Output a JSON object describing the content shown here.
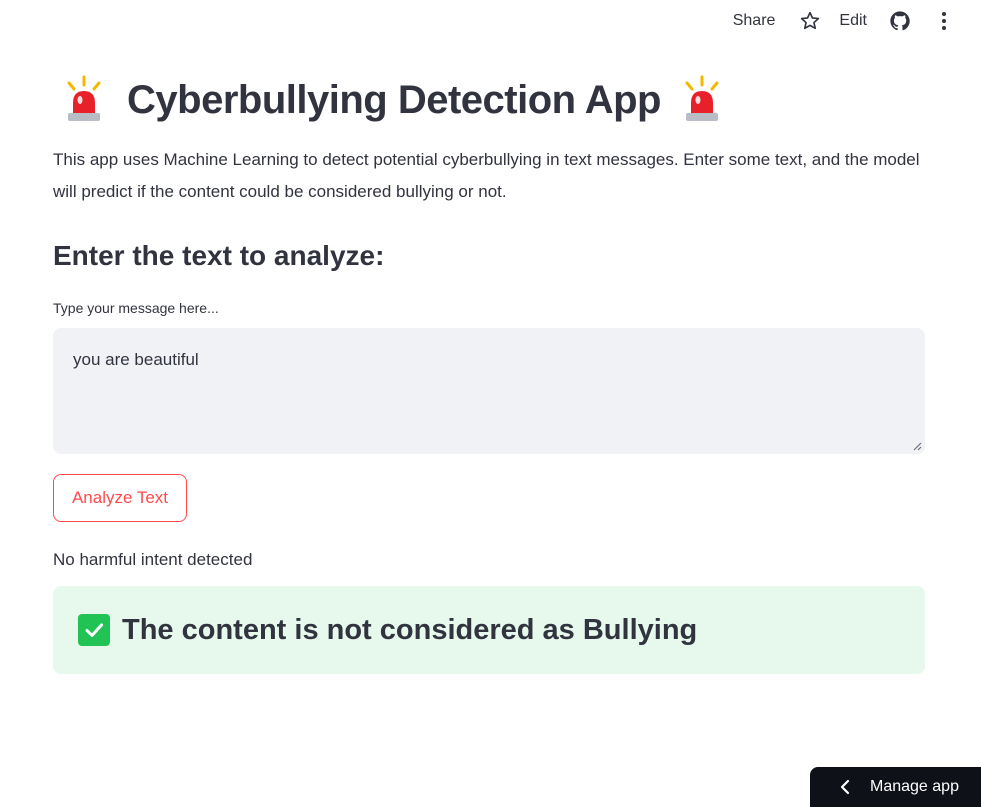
{
  "toolbar": {
    "share_label": "Share",
    "edit_label": "Edit",
    "icons": [
      "star-icon",
      "github-icon",
      "more-vertical-icon"
    ]
  },
  "header": {
    "title": "Cyberbullying Detection App",
    "icon": "siren-icon"
  },
  "main": {
    "description": "This app uses Machine Learning to detect potential cyberbullying in text messages. Enter some text, and the model will predict if the content could be considered bullying or not.",
    "subheader": "Enter the text to analyze:",
    "input": {
      "label": "Type your message here...",
      "value": "you are beautiful"
    },
    "analyze_button_label": "Analyze Text",
    "status_text": "No harmful intent detected",
    "result": {
      "text": "The content is not considered as Bullying",
      "icon": "check-mark-icon"
    }
  },
  "footer": {
    "manage_app_label": "Manage app"
  },
  "colors": {
    "accent": "#ff4b4b",
    "success_bg": "#e6f9ec",
    "success_check": "#21c354",
    "input_bg": "#f0f2f6",
    "text": "#31333f",
    "manage_bg": "#0e1117"
  }
}
